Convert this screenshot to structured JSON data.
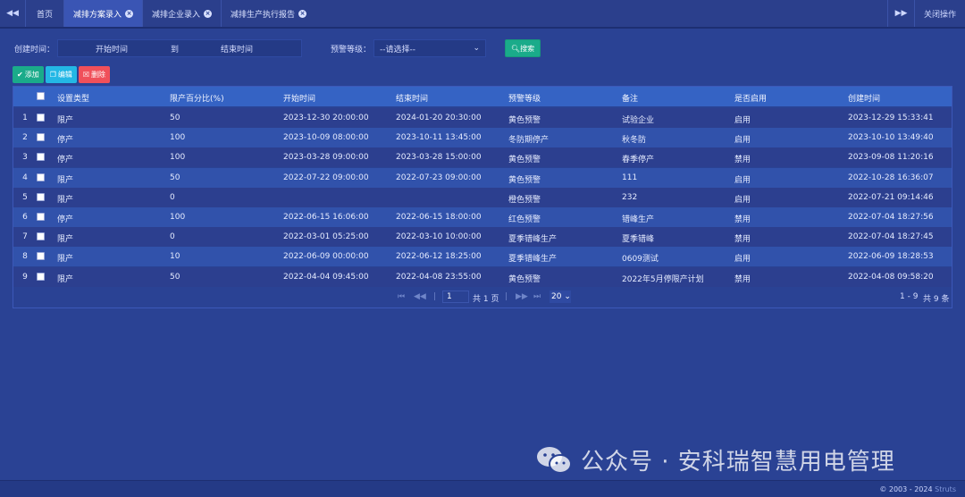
{
  "tabs": {
    "home": "首页",
    "items": [
      {
        "label": "减排方案录入",
        "active": true
      },
      {
        "label": "减排企业录入",
        "active": false
      },
      {
        "label": "减排生产执行报告",
        "active": false
      }
    ],
    "close_ops": "关闭操作"
  },
  "filter": {
    "created_label": "创建时间：",
    "start_placeholder": "开始时间",
    "to_label": "到",
    "end_placeholder": "结束时间",
    "level_label": "预警等级：",
    "level_value": "--请选择--",
    "search_label": "搜索"
  },
  "toolbar": {
    "add_label": "添加",
    "edit_label": "编辑",
    "delete_label": "删除"
  },
  "table": {
    "columns": [
      "设置类型",
      "限产百分比(%)",
      "开始时间",
      "结束时间",
      "预警等级",
      "备注",
      "是否启用",
      "创建时间"
    ],
    "rows": [
      {
        "num": "1",
        "type": "限产",
        "percent": "50",
        "start": "2023-12-30 20:00:00",
        "end": "2024-01-20 20:30:00",
        "level": "黄色预警",
        "note": "试验企业",
        "enabled": "启用",
        "created": "2023-12-29 15:33:41"
      },
      {
        "num": "2",
        "type": "停产",
        "percent": "100",
        "start": "2023-10-09 08:00:00",
        "end": "2023-10-11 13:45:00",
        "level": "冬防期停产",
        "note": "秋冬防",
        "enabled": "启用",
        "created": "2023-10-10 13:49:40"
      },
      {
        "num": "3",
        "type": "停产",
        "percent": "100",
        "start": "2023-03-28 09:00:00",
        "end": "2023-03-28 15:00:00",
        "level": "黄色预警",
        "note": "春季停产",
        "enabled": "禁用",
        "created": "2023-09-08 11:20:16"
      },
      {
        "num": "4",
        "type": "限产",
        "percent": "50",
        "start": "2022-07-22 09:00:00",
        "end": "2022-07-23 09:00:00",
        "level": "黄色预警",
        "note": "111",
        "enabled": "启用",
        "created": "2022-10-28 16:36:07"
      },
      {
        "num": "5",
        "type": "限产",
        "percent": "0",
        "start": "",
        "end": "",
        "level": "橙色预警",
        "note": "232",
        "enabled": "启用",
        "created": "2022-07-21 09:14:46"
      },
      {
        "num": "6",
        "type": "停产",
        "percent": "100",
        "start": "2022-06-15 16:06:00",
        "end": "2022-06-15 18:00:00",
        "level": "红色预警",
        "note": "错峰生产",
        "enabled": "禁用",
        "created": "2022-07-04 18:27:56"
      },
      {
        "num": "7",
        "type": "限产",
        "percent": "0",
        "start": "2022-03-01 05:25:00",
        "end": "2022-03-10 10:00:00",
        "level": "夏季错峰生产",
        "note": "夏季错峰",
        "enabled": "禁用",
        "created": "2022-07-04 18:27:45"
      },
      {
        "num": "8",
        "type": "限产",
        "percent": "10",
        "start": "2022-06-09 00:00:00",
        "end": "2022-06-12 18:25:00",
        "level": "夏季错峰生产",
        "note": "0609测试",
        "enabled": "启用",
        "created": "2022-06-09 18:28:53"
      },
      {
        "num": "9",
        "type": "限产",
        "percent": "50",
        "start": "2022-04-04 09:45:00",
        "end": "2022-04-08 23:55:00",
        "level": "黄色预警",
        "note": "2022年5月停限产计划",
        "enabled": "禁用",
        "created": "2022-04-08 09:58:20"
      }
    ]
  },
  "pager": {
    "page": "1",
    "total_pages": "共 1 页",
    "page_size": "20",
    "range": "1 - 9",
    "total": "共 9 条"
  },
  "watermark": {
    "text": "公众号 · 安科瑞智慧用电管理"
  },
  "footer": {
    "copyright": "© 2003 - 2024",
    "brand": "Struts"
  },
  "colors": {
    "background": "#2a4294",
    "header_row": "#3563c4",
    "row_odd": "#2c3f8f",
    "row_even": "#3152ab",
    "btn_green": "#1aab8a",
    "btn_blue": "#23b7e5",
    "btn_red": "#f0505a"
  }
}
